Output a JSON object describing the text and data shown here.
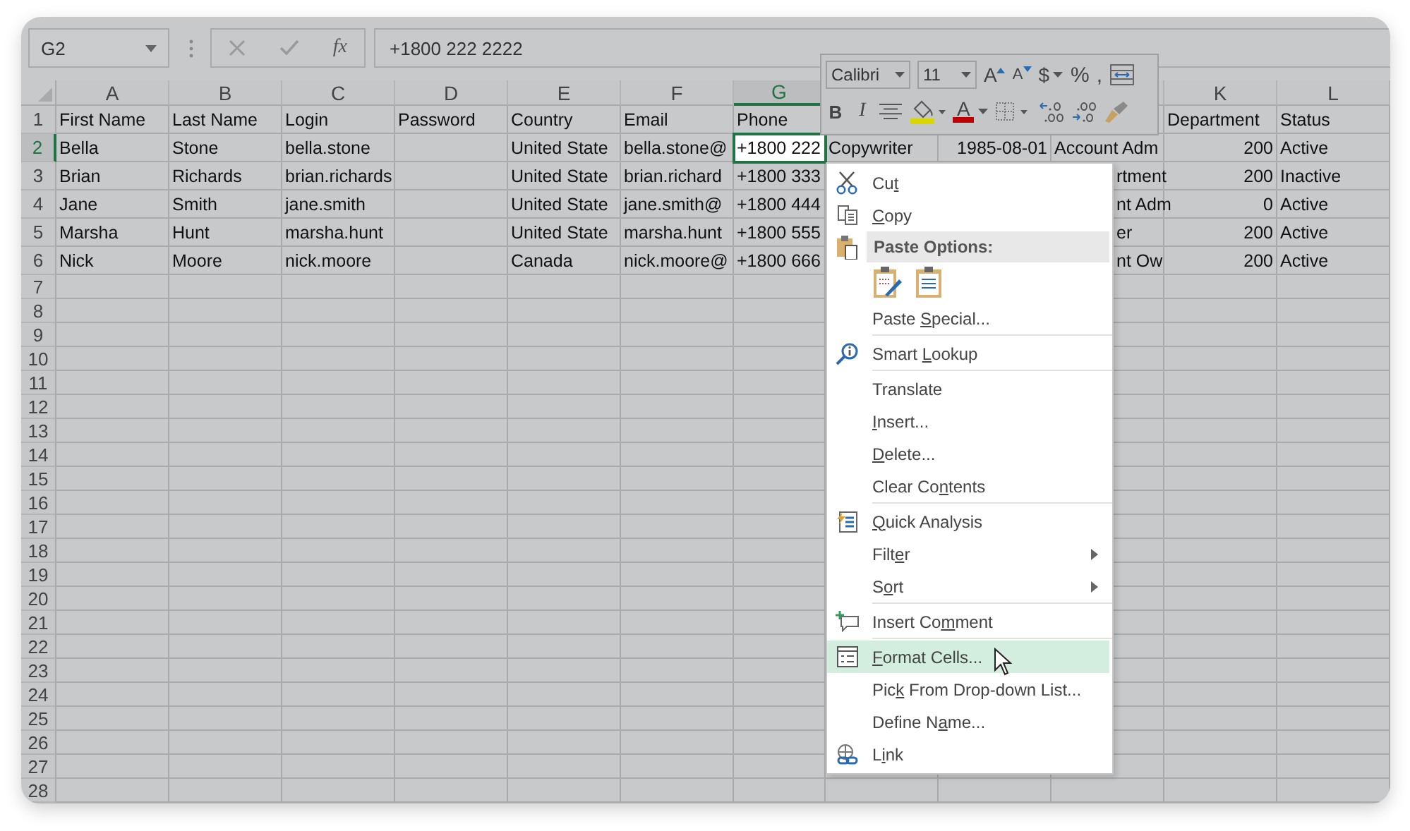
{
  "name_box": {
    "value": "G2"
  },
  "formula_bar": {
    "function_label": "fx",
    "value": "+1800 222 2222"
  },
  "columns": [
    {
      "label": "A",
      "selected": false
    },
    {
      "label": "B",
      "selected": false
    },
    {
      "label": "C",
      "selected": false
    },
    {
      "label": "D",
      "selected": false
    },
    {
      "label": "E",
      "selected": false
    },
    {
      "label": "F",
      "selected": false
    },
    {
      "label": "G",
      "selected": true
    },
    {},
    {},
    {},
    {
      "label": "K",
      "selected": false
    },
    {
      "label": "L",
      "selected": false
    }
  ],
  "rows": [
    {
      "number": "1",
      "selected": false,
      "cells": [
        "First Name",
        "Last Name",
        "Login",
        "Password",
        "Country",
        "Email",
        "Phone",
        null,
        null,
        null,
        "Department",
        "Status"
      ]
    },
    {
      "number": "2",
      "selected": true,
      "cells": [
        "Bella",
        "Stone",
        "bella.stone",
        null,
        "United State",
        "bella.stone@",
        "+1800 222",
        "Copywriter",
        "1985-08-01",
        "Account Adm",
        "200",
        "Active"
      ]
    },
    {
      "number": "3",
      "selected": false,
      "cells": [
        "Brian",
        "Richards",
        "brian.richards",
        null,
        "United State",
        "brian.richard",
        "+1800 333",
        null,
        null,
        "rtment",
        "200",
        "Inactive"
      ]
    },
    {
      "number": "4",
      "selected": false,
      "cells": [
        "Jane",
        "Smith",
        "jane.smith",
        null,
        "United State",
        "jane.smith@",
        "+1800 444",
        null,
        null,
        "nt Adm",
        "0",
        "Active"
      ]
    },
    {
      "number": "5",
      "selected": false,
      "cells": [
        "Marsha",
        "Hunt",
        "marsha.hunt",
        null,
        "United State",
        "marsha.hunt",
        "+1800 555",
        null,
        null,
        "er",
        "200",
        "Active"
      ]
    },
    {
      "number": "6",
      "selected": false,
      "cells": [
        "Nick",
        "Moore",
        "nick.moore",
        null,
        "Canada",
        "nick.moore@",
        "+1800 666",
        null,
        null,
        "nt Ow",
        "200",
        "Active"
      ]
    },
    {
      "number": "7",
      "selected": false
    },
    {
      "number": "8",
      "selected": false
    },
    {
      "number": "9",
      "selected": false
    },
    {
      "number": "10",
      "selected": false
    },
    {
      "number": "11",
      "selected": false
    },
    {
      "number": "12",
      "selected": false
    },
    {
      "number": "13",
      "selected": false
    },
    {
      "number": "14",
      "selected": false
    },
    {
      "number": "15",
      "selected": false
    },
    {
      "number": "16",
      "selected": false
    },
    {
      "number": "17",
      "selected": false
    },
    {
      "number": "18",
      "selected": false
    },
    {
      "number": "19",
      "selected": false
    },
    {
      "number": "20",
      "selected": false
    },
    {
      "number": "21",
      "selected": false
    },
    {
      "number": "22",
      "selected": false
    },
    {
      "number": "23",
      "selected": false
    },
    {
      "number": "24",
      "selected": false
    },
    {
      "number": "25",
      "selected": false
    },
    {
      "number": "26",
      "selected": false
    },
    {
      "number": "27",
      "selected": false
    },
    {
      "number": "28",
      "selected": false
    }
  ],
  "mini_toolbar": {
    "font_row": [
      {
        "kind": "select",
        "value": "Calibri"
      },
      {
        "kind": "select",
        "value": "11"
      },
      {
        "kind": "grow",
        "label": "A"
      },
      {
        "kind": "shrink",
        "label": "A"
      },
      {
        "kind": "dropdown",
        "label": "$"
      },
      {
        "kind": "text",
        "label": "%"
      },
      {
        "kind": "text",
        "label": ","
      },
      {
        "kind": "wrap"
      }
    ],
    "format_row": [
      {
        "kind": "bold",
        "label": "B"
      },
      {
        "kind": "italic",
        "label": "I"
      },
      {
        "kind": "align"
      },
      {
        "kind": "fill",
        "color": "#d8d800"
      },
      {
        "kind": "fontcolor",
        "label": "A",
        "color": "#c00000"
      },
      {
        "kind": "borders"
      },
      {
        "kind": "incdec"
      },
      {
        "kind": "decdec"
      },
      {
        "kind": "painter"
      }
    ]
  },
  "context_menu": {
    "items": [
      {
        "kind": "item",
        "label": "Cut",
        "selected": false
      },
      {
        "kind": "item",
        "label": "Copy",
        "selected": false
      },
      {
        "kind": "header",
        "label": "Paste Options:"
      },
      {
        "kind": "paste_icons"
      },
      {
        "kind": "item",
        "label": "Paste Special...",
        "selected": false
      },
      {
        "kind": "separator"
      },
      {
        "kind": "item",
        "label": "Smart Lookup",
        "selected": false
      },
      {
        "kind": "separator"
      },
      {
        "kind": "item",
        "label": "Translate",
        "selected": false
      },
      {
        "kind": "item",
        "label": "Insert...",
        "selected": false
      },
      {
        "kind": "item",
        "label": "Delete...",
        "selected": false
      },
      {
        "kind": "item",
        "label": "Clear Contents",
        "selected": false
      },
      {
        "kind": "separator"
      },
      {
        "kind": "item",
        "label": "Quick Analysis",
        "selected": false
      },
      {
        "kind": "item",
        "label": "Filter",
        "submenu": true,
        "selected": false
      },
      {
        "kind": "item",
        "label": "Sort",
        "submenu": true,
        "selected": false
      },
      {
        "kind": "separator"
      },
      {
        "kind": "item",
        "label": "Insert Comment",
        "selected": false
      },
      {
        "kind": "separator"
      },
      {
        "kind": "item",
        "label": "Format Cells...",
        "selected": true
      },
      {
        "kind": "item",
        "label": "Pick From Drop-down List...",
        "selected": false
      },
      {
        "kind": "item",
        "label": "Define Name...",
        "selected": false
      },
      {
        "kind": "item",
        "label": "Link",
        "selected": false
      }
    ]
  }
}
